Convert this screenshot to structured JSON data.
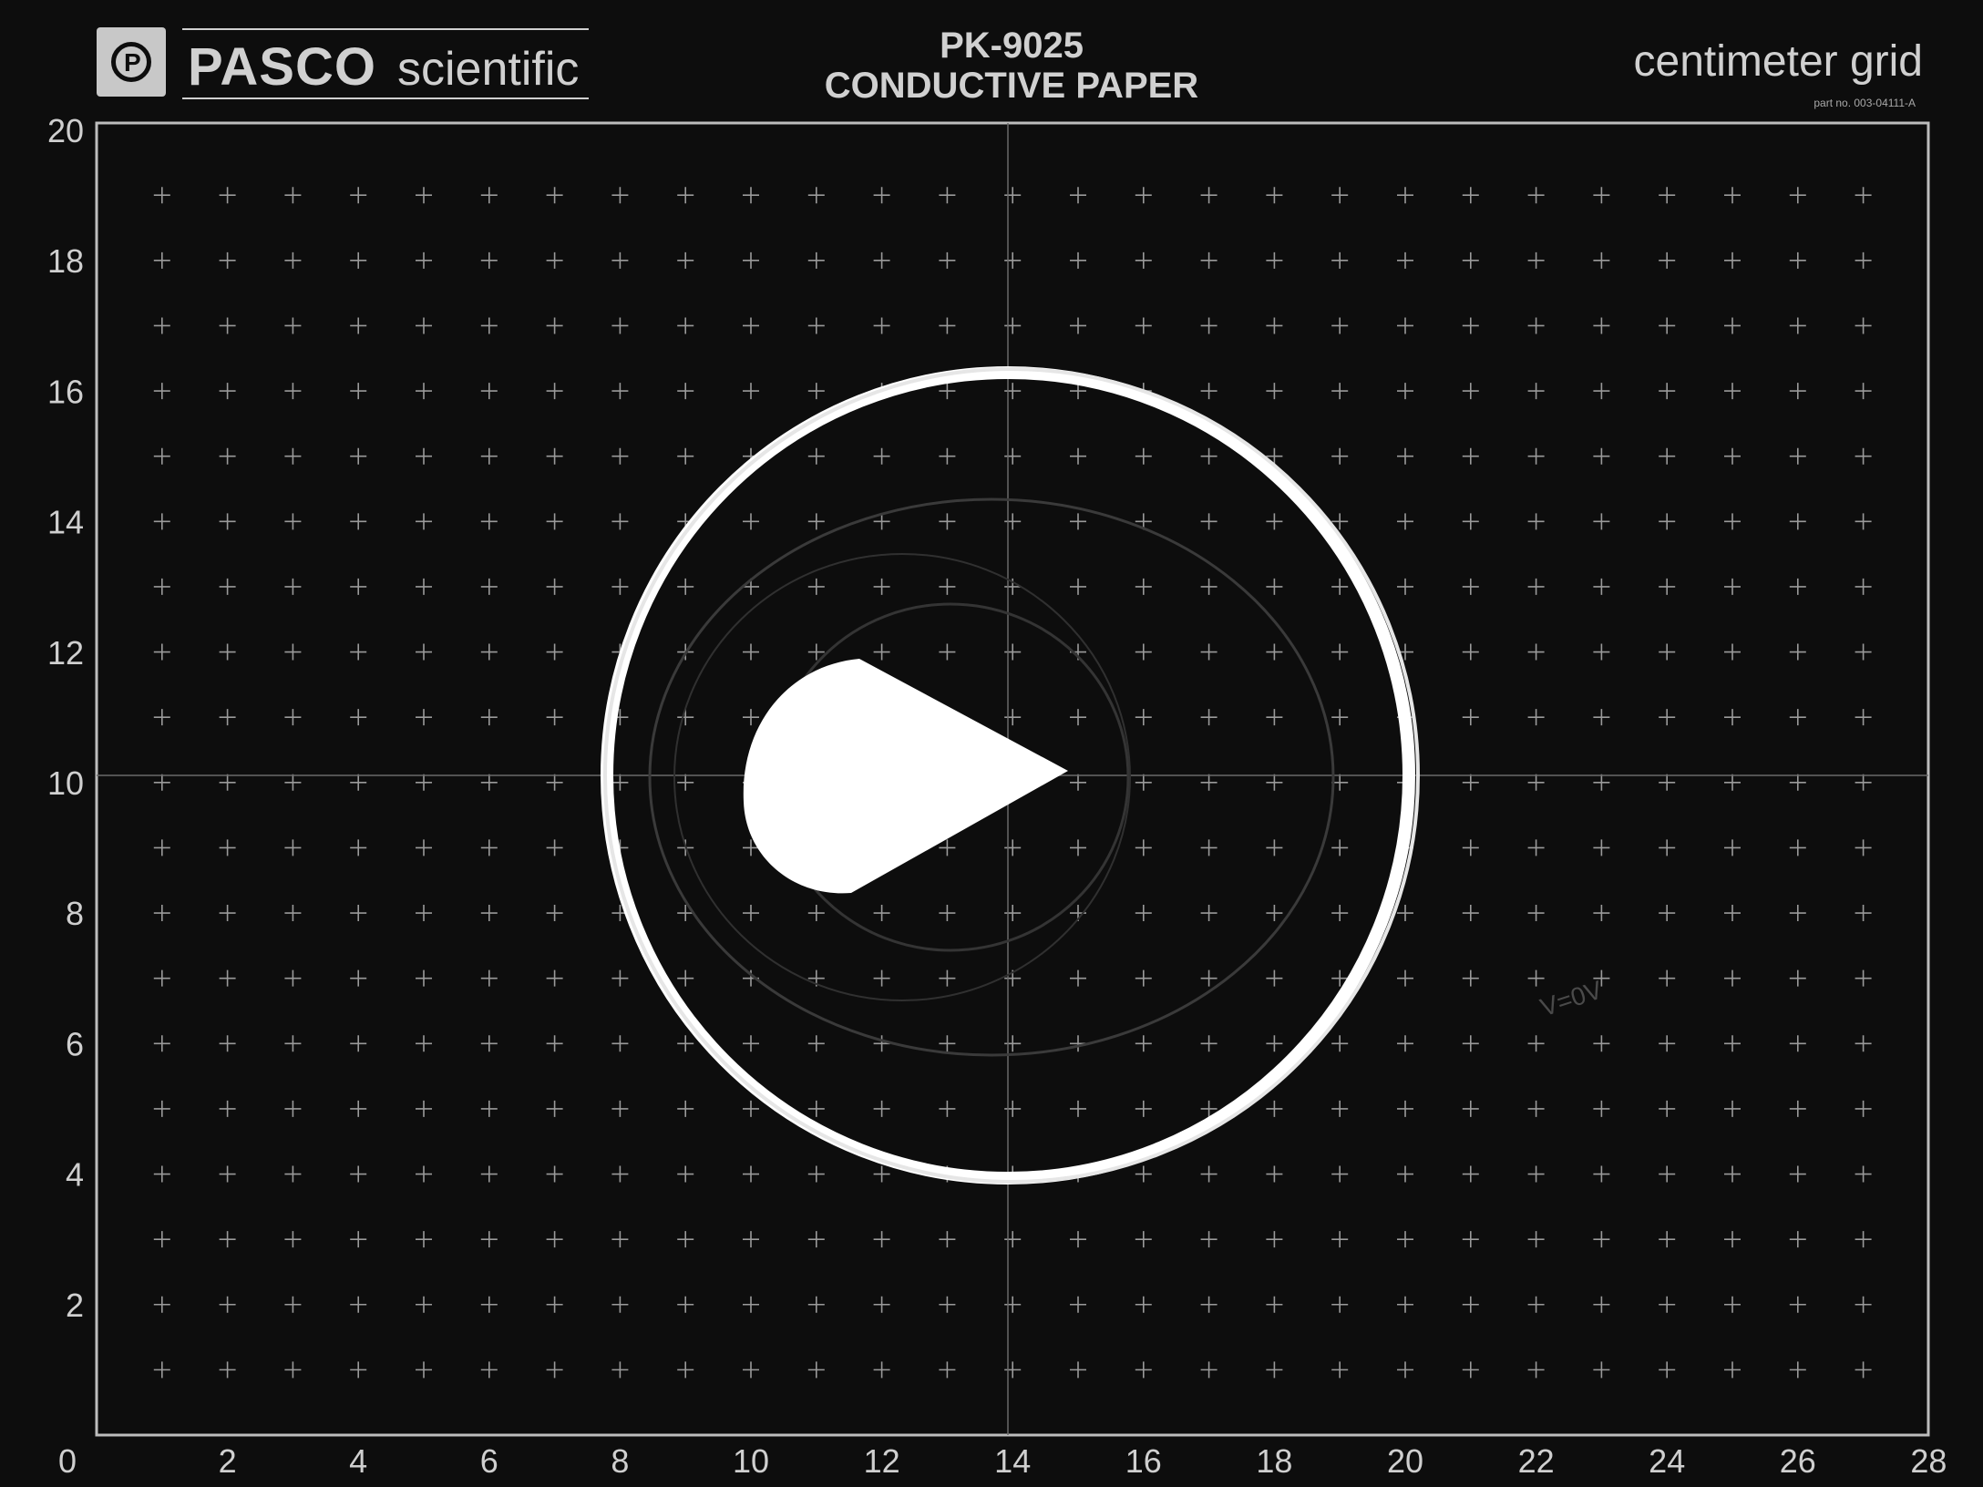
{
  "header": {
    "brand": "PASCO",
    "brand_sub": "scientific",
    "logo_letter": "P",
    "product_code": "PK-9025",
    "product_name": "CONDUCTIVE PAPER",
    "grid_name": "centimeter grid",
    "part_no": "part no. 003-04111-A"
  },
  "axes": {
    "y_ticks": [
      "0",
      "2",
      "4",
      "6",
      "8",
      "10",
      "12",
      "14",
      "16",
      "18",
      "20"
    ],
    "x_ticks": [
      "2",
      "4",
      "6",
      "8",
      "10",
      "12",
      "14",
      "16",
      "18",
      "20",
      "22",
      "24",
      "26",
      "28"
    ]
  },
  "handwriting": "V=0V",
  "colors": {
    "paper": "#0d0d0d",
    "ink": "#cfcfcf",
    "electrode": "#ffffff",
    "trace": "#3a3a3a"
  }
}
